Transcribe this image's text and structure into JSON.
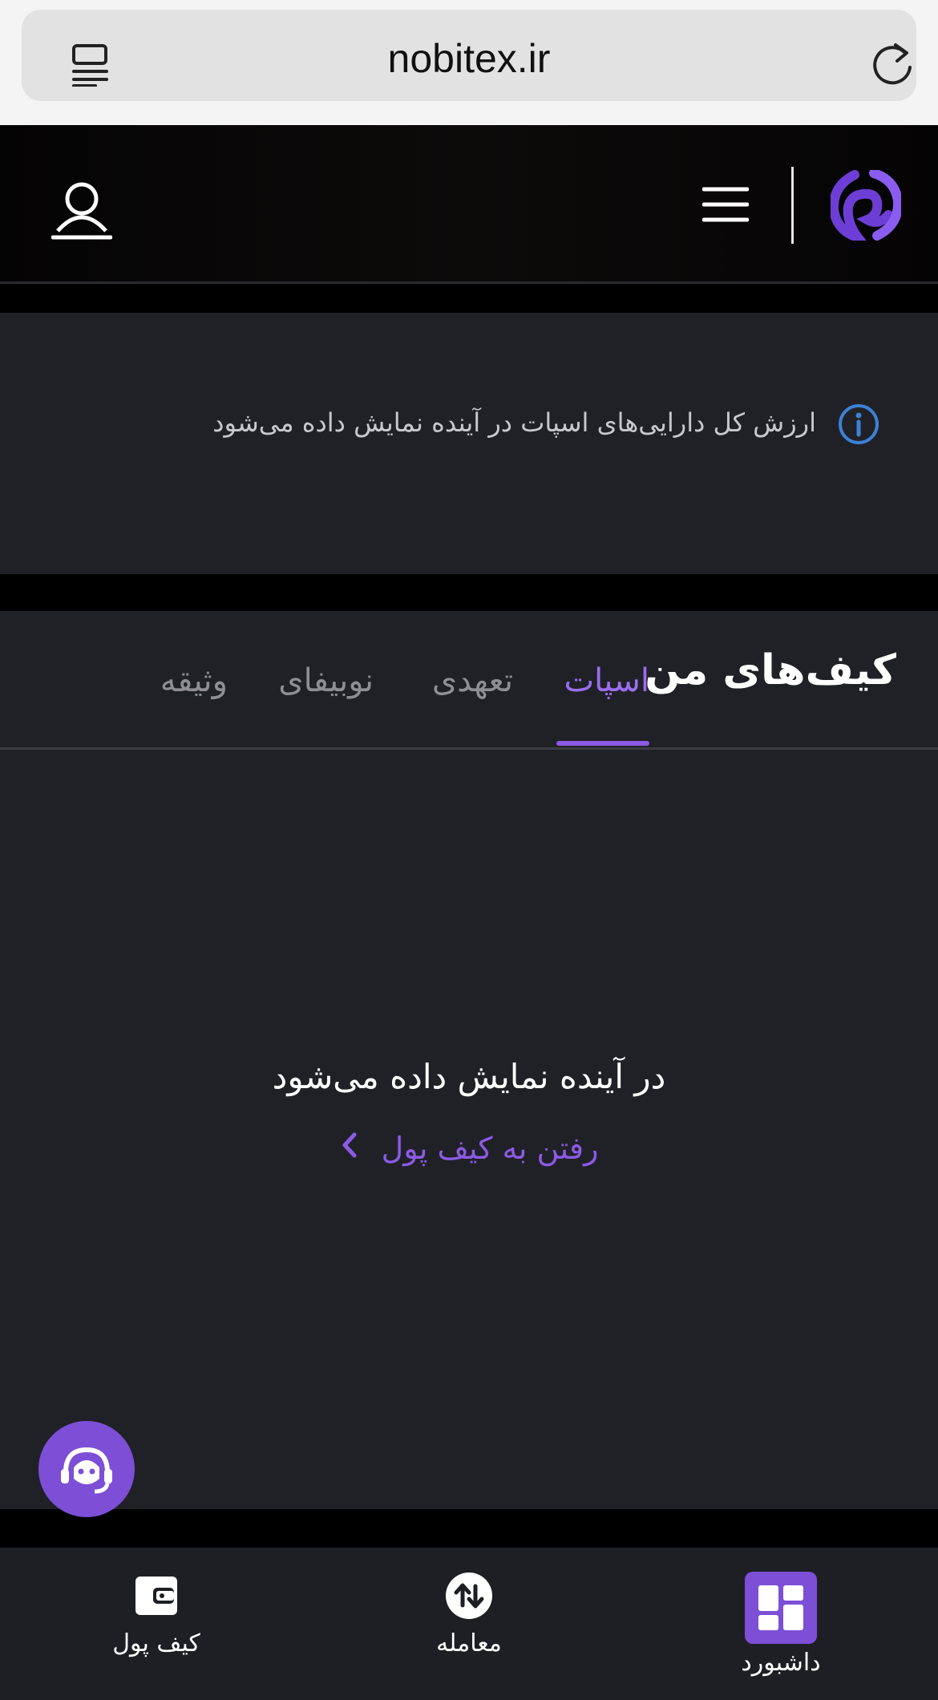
{
  "browser": {
    "url": "nobitex.ir",
    "reader_icon": "reader-mode-icon",
    "reload_icon": "reload-icon"
  },
  "header": {
    "user_icon": "user-icon",
    "menu_icon": "hamburger-menu-icon",
    "logo_icon": "nobitex-logo-icon"
  },
  "info": {
    "text": "ارزش کل دارایی‌های اسپات در آینده نمایش داده می‌شود",
    "icon": "info-icon"
  },
  "wallets": {
    "title": "کیف‌های من",
    "tabs": [
      {
        "label": "اسپات",
        "active": true
      },
      {
        "label": "تعهدی",
        "active": false
      },
      {
        "label": "نوبیفای",
        "active": false
      },
      {
        "label": "وثیقه",
        "active": false
      }
    ],
    "empty_message": "در آینده نمایش داده می‌شود",
    "goto_wallet": "رفتن به کیف پول"
  },
  "support": {
    "icon": "support-headset-icon"
  },
  "bottom_nav": {
    "items": [
      {
        "label": "کیف پول",
        "icon": "wallet-icon"
      },
      {
        "label": "معامله",
        "icon": "trade-arrows-icon"
      },
      {
        "label": "داشبورد",
        "icon": "dashboard-icon",
        "active": true
      }
    ]
  },
  "colors": {
    "accent": "#8c5ae6",
    "panel": "#202127",
    "background": "#000000",
    "info_blue": "#3b82d6"
  }
}
